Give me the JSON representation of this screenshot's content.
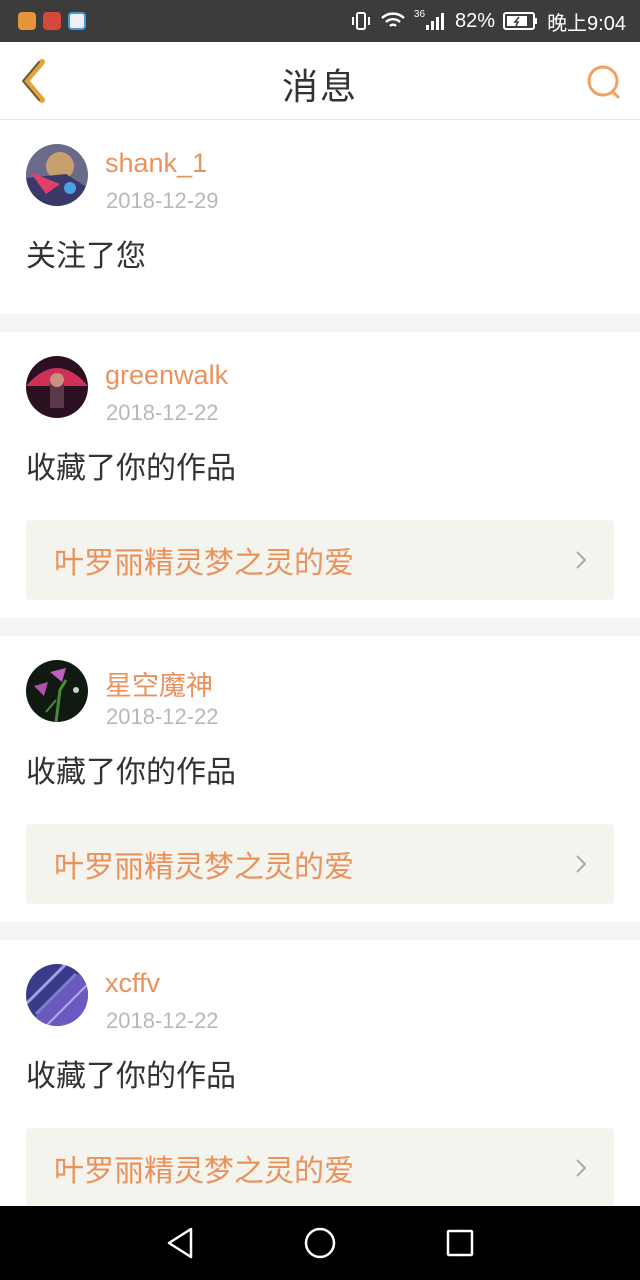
{
  "statusbar": {
    "signal_tag": "36",
    "battery": "82%",
    "time": "晚上9:04",
    "app_icons": [
      "video-app-icon",
      "game-app-icon",
      "browser-app-icon"
    ]
  },
  "header": {
    "title": "消息",
    "back_icon": "back-chevron-icon",
    "search_icon": "search-icon"
  },
  "colors": {
    "accent": "#e9925d",
    "text": "#333333",
    "muted": "#b8b8b8",
    "work_bg": "#f4f4ee"
  },
  "messages": [
    {
      "user": "shank_1",
      "date": "2018-12-29",
      "action": "关注了您"
    },
    {
      "user": "greenwalk",
      "date": "2018-12-22",
      "action": "收藏了你的作品",
      "work": "叶罗丽精灵梦之灵的爱"
    },
    {
      "user": "星空魔神",
      "date": "2018-12-22",
      "action": "收藏了你的作品",
      "work": "叶罗丽精灵梦之灵的爱"
    },
    {
      "user": "xcffv",
      "date": "2018-12-22",
      "action": "收藏了你的作品",
      "work": "叶罗丽精灵梦之灵的爱"
    }
  ]
}
